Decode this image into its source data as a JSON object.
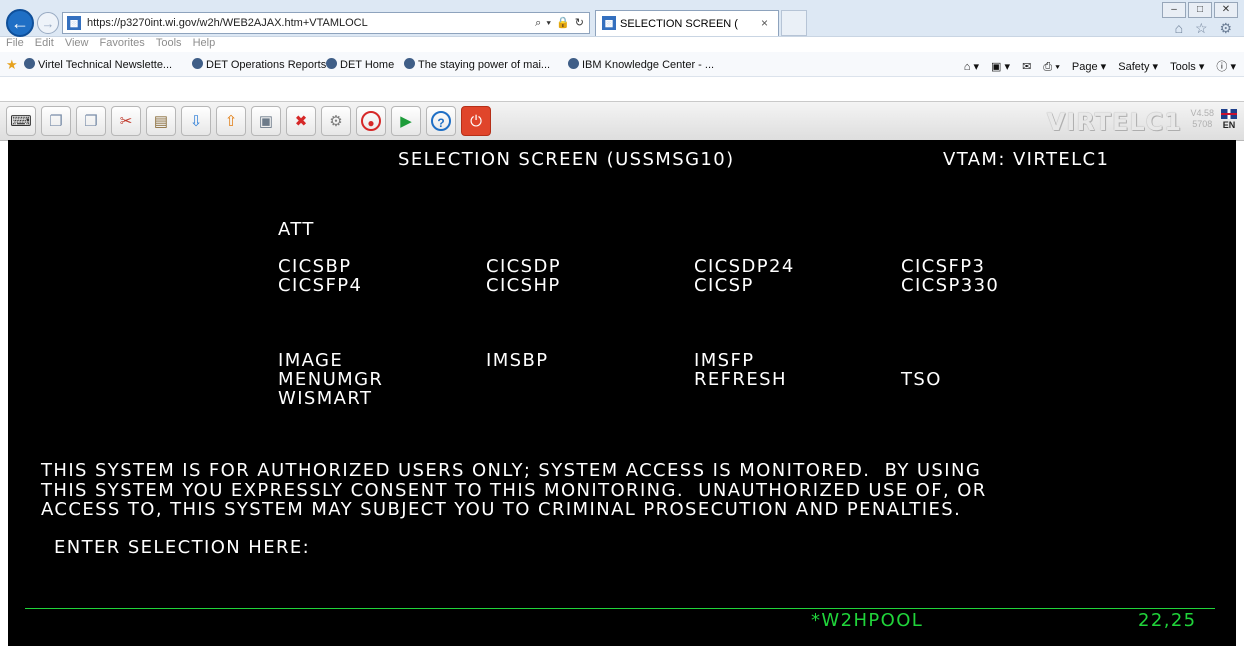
{
  "browser": {
    "address_url": "https://p3270int.wi.gov/w2h/WEB2AJAX.htm+VTAMLOCL",
    "address_tools": "⌕ ▾ 🔒 ↻",
    "tab_title": "SELECTION SCREEN (",
    "tab_close": "×",
    "window_controls": [
      "–",
      "□",
      "✕"
    ],
    "toolbar_right_icons": "⌂ ☆ ⚙",
    "menu": [
      "File",
      "Edit",
      "View",
      "Favorites",
      "Tools",
      "Help"
    ],
    "favorites": [
      "Virtel Technical Newslette...",
      "DET Operations Reports",
      "DET Home",
      "The staying power of mai...",
      "IBM Knowledge Center - ..."
    ],
    "command_bar": [
      "⌂ ▾",
      "▣ ▾",
      "✉",
      "⎙ ▾",
      "Page ▾",
      "Safety ▾",
      "Tools ▾",
      "ⓘ ▾"
    ]
  },
  "virtel_toolbar": {
    "buttons": [
      {
        "name": "keyboard-icon",
        "glyph": "⌨",
        "color": "#333333"
      },
      {
        "name": "copy-icon",
        "glyph": "❐",
        "color": "#7a8ea9"
      },
      {
        "name": "paste-screen-icon",
        "glyph": "❐",
        "color": "#7a8ea9"
      },
      {
        "name": "cut-icon",
        "glyph": "✂",
        "color": "#c0392b"
      },
      {
        "name": "clipboard-icon",
        "glyph": "▤",
        "color": "#8a6d3b"
      },
      {
        "name": "download-icon",
        "glyph": "⇩",
        "color": "#2f7fd8"
      },
      {
        "name": "upload-icon",
        "glyph": "⇧",
        "color": "#e07b10"
      },
      {
        "name": "print-screen-icon",
        "glyph": "▣",
        "color": "#6c7a89"
      },
      {
        "name": "disconnect-icon",
        "glyph": "✖",
        "color": "#d62828"
      },
      {
        "name": "settings-icon",
        "glyph": "⚙",
        "color": "#7d7d7d"
      },
      {
        "name": "record-icon",
        "glyph": "●",
        "color": "#d62828"
      },
      {
        "name": "play-icon",
        "glyph": "▶",
        "color": "#1e9c3a"
      },
      {
        "name": "help-icon",
        "glyph": "?",
        "color": "#1f6fc5"
      },
      {
        "name": "power-icon",
        "glyph": "⏻",
        "color": "#ffffff"
      }
    ],
    "brand": "VIRTELC1",
    "version": "V4.58",
    "build": "5708",
    "language": "EN"
  },
  "terminal": {
    "header_title": "SELECTION SCREEN (USSMSG10)",
    "vtam_label": "VTAM: VIRTELC1",
    "groups": [
      [
        "ATT"
      ],
      [
        "CICSBP",
        "CICSDP",
        "CICSDP24",
        "CICSFP3"
      ],
      [
        "CICSFP4",
        "CICSHP",
        "CICSP",
        "CICSP330"
      ],
      [
        "IMAGE",
        "IMSBP",
        "IMSFP"
      ],
      [
        "MENUMGR",
        "REFRESH",
        "TSO"
      ],
      [
        "WISMART"
      ]
    ],
    "warning_lines": [
      "THIS SYSTEM IS FOR AUTHORIZED USERS ONLY; SYSTEM ACCESS IS MONITORED.  BY USING",
      "THIS SYSTEM YOU EXPRESSLY CONSENT TO THIS MONITORING.  UNAUTHORIZED USE OF, OR",
      "ACCESS TO, THIS SYSTEM MAY SUBJECT YOU TO CRIMINAL PROSECUTION AND PENALTIES."
    ],
    "prompt": "ENTER SELECTION HERE:",
    "selection_value": "",
    "status_pool": "*W2HPOOL",
    "cursor_position": "22,25"
  },
  "colors": {
    "terminal_bg": "#000000",
    "terminal_text": "#ffffff",
    "status_green": "#20d43a"
  }
}
